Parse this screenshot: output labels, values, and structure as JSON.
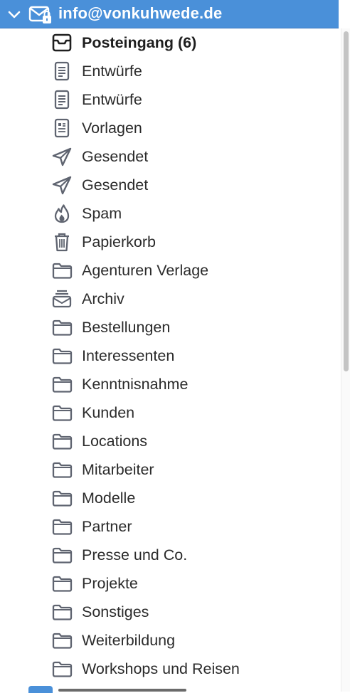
{
  "colors": {
    "selection": "#4a90d9",
    "icon": "#5f6470",
    "text": "#2b2b2b"
  },
  "account": {
    "label": "info@vonkuhwede.de",
    "icon": "envelope-lock-icon",
    "expanded": true
  },
  "folders": [
    {
      "label": "Posteingang (6)",
      "icon": "inbox-icon",
      "bold": true
    },
    {
      "label": "Entwürfe",
      "icon": "document-icon"
    },
    {
      "label": "Entwürfe",
      "icon": "document-icon"
    },
    {
      "label": "Vorlagen",
      "icon": "template-icon"
    },
    {
      "label": "Gesendet",
      "icon": "paper-plane-icon"
    },
    {
      "label": "Gesendet",
      "icon": "paper-plane-icon"
    },
    {
      "label": "Spam",
      "icon": "flame-icon"
    },
    {
      "label": "Papierkorb",
      "icon": "trash-icon"
    },
    {
      "label": "Agenturen Verlage",
      "icon": "folder-icon"
    },
    {
      "label": "Archiv",
      "icon": "archive-icon"
    },
    {
      "label": "Bestellungen",
      "icon": "folder-icon"
    },
    {
      "label": "Interessenten",
      "icon": "folder-icon"
    },
    {
      "label": "Kenntnisnahme",
      "icon": "folder-icon"
    },
    {
      "label": "Kunden",
      "icon": "folder-icon"
    },
    {
      "label": "Locations",
      "icon": "folder-icon"
    },
    {
      "label": "Mitarbeiter",
      "icon": "folder-icon"
    },
    {
      "label": "Modelle",
      "icon": "folder-icon"
    },
    {
      "label": "Partner",
      "icon": "folder-icon"
    },
    {
      "label": "Presse und Co.",
      "icon": "folder-icon"
    },
    {
      "label": "Projekte",
      "icon": "folder-icon"
    },
    {
      "label": "Sonstiges",
      "icon": "folder-icon"
    },
    {
      "label": "Weiterbildung",
      "icon": "folder-icon"
    },
    {
      "label": "Workshops und Reisen",
      "icon": "folder-icon"
    }
  ]
}
